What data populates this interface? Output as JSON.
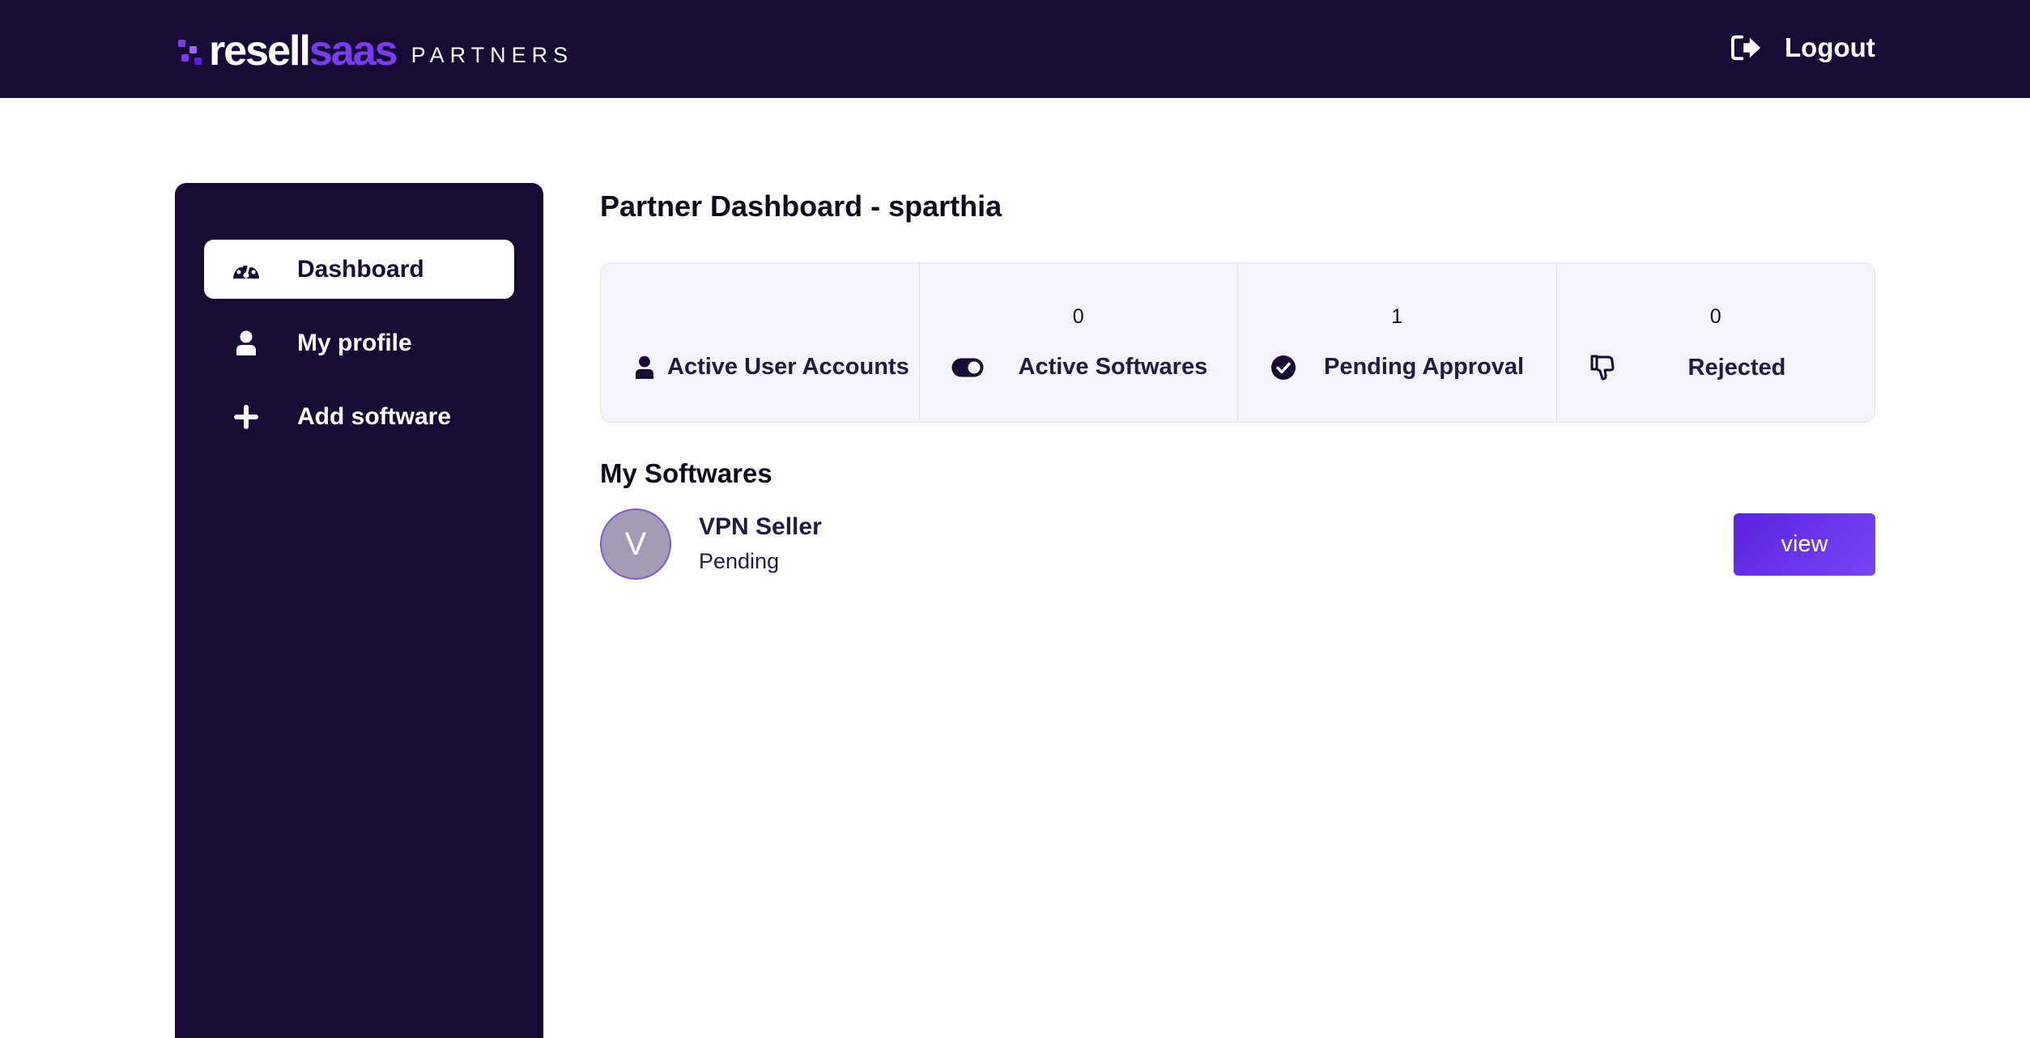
{
  "header": {
    "logo": {
      "word_part1": "resell",
      "word_part2": "saas",
      "subtitle": "PARTNERS"
    },
    "logout_label": "Logout"
  },
  "sidebar": {
    "items": [
      {
        "label": "Dashboard",
        "icon": "tachometer-icon",
        "active": true
      },
      {
        "label": "My profile",
        "icon": "user-icon",
        "active": false
      },
      {
        "label": "Add software",
        "icon": "plus-icon",
        "active": false
      }
    ]
  },
  "main": {
    "title": "Partner Dashboard - sparthia",
    "stats": [
      {
        "label": "Active User Accounts",
        "value": "",
        "icon": "user-icon"
      },
      {
        "label": "Active Softwares",
        "value": "0",
        "icon": "toggle-on-icon"
      },
      {
        "label": "Pending Approval",
        "value": "1",
        "icon": "check-circle-icon"
      },
      {
        "label": "Rejected",
        "value": "0",
        "icon": "thumbs-down-icon"
      }
    ],
    "softwares_title": "My Softwares",
    "softwares": [
      {
        "initial": "V",
        "name": "VPN Seller",
        "status": "Pending",
        "action_label": "view"
      }
    ]
  },
  "colors": {
    "navy": "#170b35",
    "purple_accent": "#7a3cf0",
    "stats_bg": "#f4f2fb"
  }
}
